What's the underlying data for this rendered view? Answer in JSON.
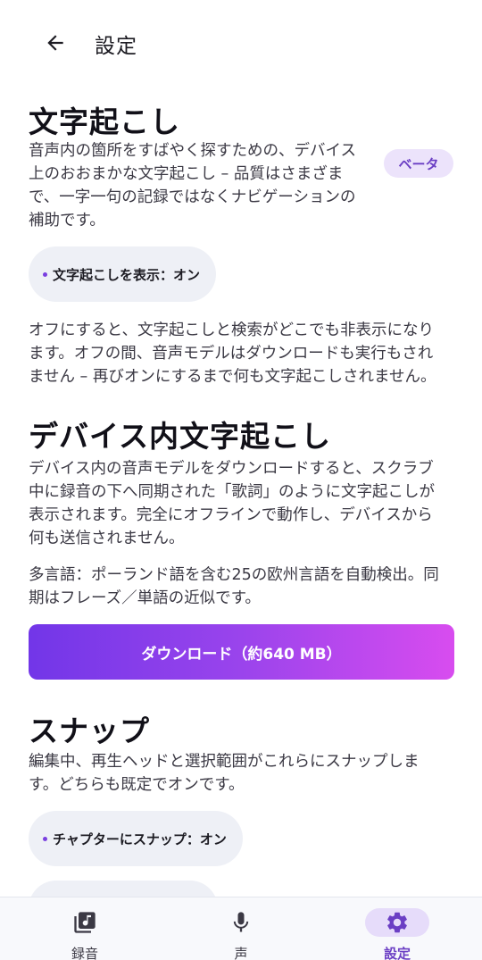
{
  "header": {
    "title": "設定",
    "back_icon": "arrow-left-icon"
  },
  "transcription": {
    "title": "文字起こし",
    "description": "音声内の箇所をすばやく探すための、デバイス上のおおまかな文字起こし – 品質はさまざまで、一字一句の記録ではなくナビゲーションの補助です。",
    "description_lines": [
      "音声内の箇所をすばやく探すための、デバイス",
      "上のおおまかな文字起こし – 品質はさまざま",
      "で、一字一句の記録ではなくナビゲーションの",
      "補助です。"
    ],
    "badge": "ベータ",
    "toggle_label": "文字起こしを表示：オン",
    "note_lines": [
      "オフにすると、文字起こしと検索がどこでも非表示になり",
      "ます。オフの間、音声モデルはダウンロードも実行もされ",
      "ません – 再びオンにするまで何も文字起こしされません。"
    ]
  },
  "on_device": {
    "title": "デバイス内文字起こし",
    "description_lines": [
      "デバイス内の音声モデルをダウンロードすると、スクラブ",
      "中に録音の下へ同期された「歌詞」のように文字起こしが",
      "表示されます。完全にオフラインで動作し、デバイスから",
      "何も送信されません。"
    ],
    "multilang_lines": [
      "多言語：ポーランド語を含む25の欧州言語を自動検出。同",
      "期はフレーズ／単語の近似です。"
    ],
    "download_label": "ダウンロード（約640 MB）"
  },
  "snap": {
    "title": "スナップ",
    "description_lines": [
      "編集中、再生ヘッドと選択範囲がこれらにスナップしま",
      "す。どちらも既定でオンです。"
    ],
    "chapter_toggle_label": "チャプターにスナップ：オン"
  },
  "bottom_nav": {
    "items": [
      {
        "label": "録音",
        "icon": "recordings-library-icon",
        "active": false
      },
      {
        "label": "声",
        "icon": "microphone-icon",
        "active": false
      },
      {
        "label": "設定",
        "icon": "gear-icon",
        "active": true
      }
    ]
  },
  "colors": {
    "accent": "#6b3fc4",
    "badge_bg": "#ece3fb",
    "pill_bg": "#eef0f6",
    "gradient_start": "#7236e8",
    "gradient_end": "#d84cef"
  }
}
